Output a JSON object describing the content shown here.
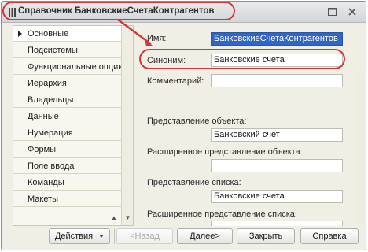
{
  "window": {
    "title": "Справочник БанковскиеСчетаКонтрагентов",
    "icon": "list-icon"
  },
  "sidebar": {
    "items": [
      {
        "label": "Основные",
        "active": true
      },
      {
        "label": "Подсистемы"
      },
      {
        "label": "Функциональные опции"
      },
      {
        "label": "Иерархия"
      },
      {
        "label": "Владельцы"
      },
      {
        "label": "Данные"
      },
      {
        "label": "Нумерация"
      },
      {
        "label": "Формы"
      },
      {
        "label": "Поле ввода"
      },
      {
        "label": "Команды"
      },
      {
        "label": "Макеты"
      }
    ]
  },
  "form": {
    "name_label": "Имя:",
    "name_value": "БанковскиеСчетаКонтрагентов",
    "synonym_label": "Синоним:",
    "synonym_value": "Банковские счета",
    "comment_label": "Комментарий:",
    "comment_value": "",
    "obj_repr_label": "Представление объекта:",
    "obj_repr_value": "Банковский счет",
    "ext_obj_repr_label": "Расширенное представление объекта:",
    "ext_obj_repr_value": "",
    "list_repr_label": "Представление списка:",
    "list_repr_value": "Банковские счета",
    "ext_list_repr_label": "Расширенное представление списка:",
    "ext_list_repr_value": ""
  },
  "buttons": {
    "actions": "Действия",
    "back": "<Назад",
    "next": "Далее>",
    "close": "Закрыть",
    "help": "Справка"
  },
  "colors": {
    "highlight": "#d6363a",
    "selection": "#3166c4"
  }
}
